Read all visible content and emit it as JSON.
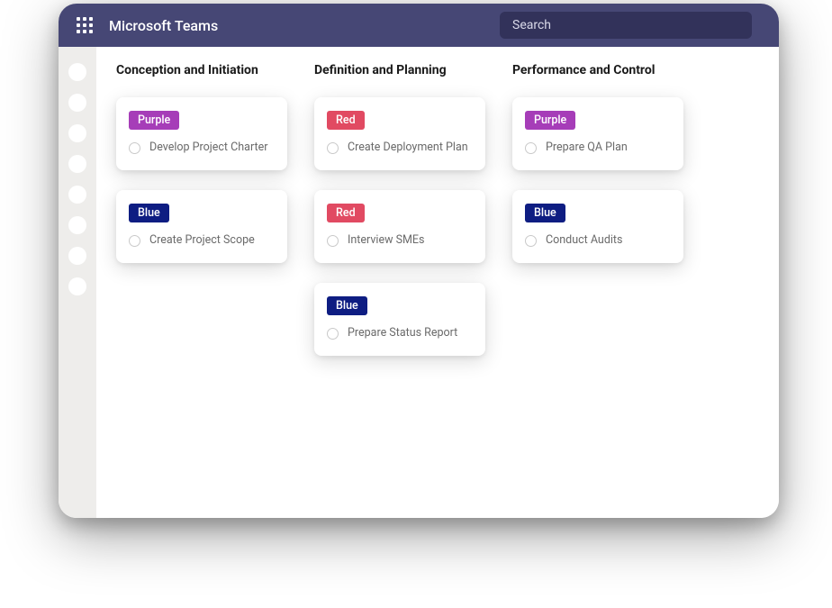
{
  "header": {
    "title": "Microsoft Teams",
    "search_placeholder": "Search"
  },
  "tag_colors": {
    "Purple": "#a63db8",
    "Red": "#e14a62",
    "Blue": "#0e1d82"
  },
  "columns": [
    {
      "title": "Conception and Initiation",
      "cards": [
        {
          "tag": "Purple",
          "task": "Develop Project Charter"
        },
        {
          "tag": "Blue",
          "task": "Create Project Scope"
        }
      ]
    },
    {
      "title": "Definition and Planning",
      "cards": [
        {
          "tag": "Red",
          "task": "Create Deployment Plan"
        },
        {
          "tag": "Red",
          "task": "Interview SMEs"
        },
        {
          "tag": "Blue",
          "task": "Prepare Status Report"
        }
      ]
    },
    {
      "title": "Performance and Control",
      "cards": [
        {
          "tag": "Purple",
          "task": "Prepare QA Plan"
        },
        {
          "tag": "Blue",
          "task": "Conduct Audits"
        }
      ]
    }
  ]
}
